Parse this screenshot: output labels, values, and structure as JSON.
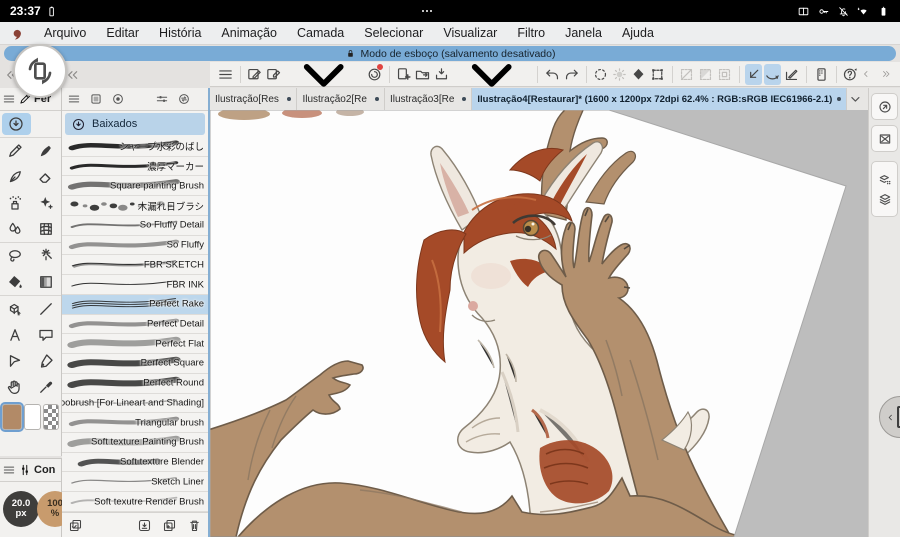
{
  "colors": {
    "banner_blue": "#79abd6",
    "selection_blue": "#b9d4ec",
    "workspace_gray": "#bdbdbd",
    "foreground_swatch": "#b28a67",
    "mane_red": "#a54a28",
    "body_cream": "#f2ece3",
    "skin_tan": "#b3906e"
  },
  "status_bar": {
    "time": "23:37",
    "left_icons": [
      "battery-small-icon"
    ],
    "center_icon": "three-dots-icon",
    "right_icons": [
      "book-icon",
      "key-icon",
      "bell-off-icon",
      "wifi-icon",
      "battery-icon"
    ]
  },
  "menu_bar": {
    "logo_icon": "medibang-logo",
    "items": [
      "Arquivo",
      "Editar",
      "História",
      "Animação",
      "Camada",
      "Selecionar",
      "Visualizar",
      "Filtro",
      "Janela",
      "Ajuda"
    ]
  },
  "notice_bar": {
    "icon": "lock-icon",
    "text": "Modo de esboço (salvamento desativado)"
  },
  "collapse_buttons": [
    {
      "icon": "collapse-icon",
      "name": "collapse-tool-panel"
    },
    {
      "icon": "collapse-icon",
      "name": "collapse-brush-panel"
    }
  ],
  "toolbar": {
    "buttons": [
      {
        "icon": "hamburger-icon"
      },
      {
        "divider": true
      },
      {
        "icon": "new-canvas-icon"
      },
      {
        "icon": "export-image-icon",
        "chevron": true
      },
      {
        "icon": "gallery-icon",
        "badge": true
      },
      {
        "divider": true
      },
      {
        "icon": "add-file-icon"
      },
      {
        "icon": "open-folder-icon"
      },
      {
        "icon": "save-export-icon",
        "chevron": true
      },
      {
        "divider": true
      },
      {
        "icon": "undo-icon"
      },
      {
        "icon": "redo-icon"
      },
      {
        "divider": true
      },
      {
        "icon": "spinner-icon"
      },
      {
        "icon": "brightness-icon",
        "disabled": true
      },
      {
        "icon": "fill-icon"
      },
      {
        "icon": "transform-icon"
      },
      {
        "divider": true
      },
      {
        "icon": "select-none-icon",
        "disabled": true
      },
      {
        "icon": "select-inverse-icon",
        "disabled": true
      },
      {
        "icon": "select-rect-icon",
        "disabled": true
      },
      {
        "divider": true
      },
      {
        "icon": "snap-corner-icon",
        "active": true
      },
      {
        "icon": "snap-curve-icon",
        "active": true
      },
      {
        "icon": "snap-angle-icon"
      },
      {
        "divider": true
      },
      {
        "icon": "material-panel-icon"
      },
      {
        "divider": true
      },
      {
        "icon": "help-icon"
      }
    ],
    "overflow_icons": [
      "chevron-left-icon",
      "chevrons-right-icon"
    ]
  },
  "tool_panel": {
    "menu_icon": "hamburger-icon",
    "tab_icon": "pen-icon",
    "tab_label": "Fer",
    "tools": [
      {
        "icon": "downloaded-brushes-icon",
        "selected": true
      },
      {
        "icon": null
      },
      {
        "icon": "pen-icon"
      },
      {
        "icon": "brushpen-icon"
      },
      {
        "icon": "inkpen-icon"
      },
      {
        "icon": "eraser-icon"
      },
      {
        "icon": "airbrush-icon"
      },
      {
        "icon": "decoration-icon"
      },
      {
        "icon": "blend-icon"
      },
      {
        "icon": "mesh-icon"
      },
      {
        "icon": "lasso-icon"
      },
      {
        "icon": "magic-wand-icon"
      },
      {
        "icon": "bucket-icon"
      },
      {
        "icon": "gradient-icon"
      },
      {
        "icon": "operation-icon"
      },
      {
        "icon": "line-icon"
      },
      {
        "icon": "text-icon"
      },
      {
        "icon": "balloon-icon"
      },
      {
        "icon": "polygon-select-icon"
      },
      {
        "icon": "control-point-icon"
      },
      {
        "icon": "hand-icon"
      },
      {
        "icon": "eyedropper-icon"
      }
    ],
    "swatches": [
      {
        "name": "foreground-swatch",
        "color": "#b28a67",
        "selected": true
      },
      {
        "name": "background-swatch",
        "color": "#ffffff",
        "selected": false
      },
      {
        "name": "transparent-swatch",
        "pattern": "checker",
        "selected": false
      }
    ]
  },
  "config_panel": {
    "menu_icon": "hamburger-icon",
    "tab_icon": "sliders-icon",
    "tab_label": "Con",
    "brush_size": {
      "value": "20.0",
      "unit": "px"
    },
    "opacity": {
      "value": "100",
      "unit": "%"
    }
  },
  "brush_panel": {
    "tabs": [
      {
        "icon": "hamburger-icon"
      },
      {
        "icon": "layer-thumb-icon"
      },
      {
        "icon": "record-icon"
      },
      {
        "icon": "brush-tab-icon",
        "active": true
      },
      {
        "icon": "settings-icon"
      },
      {
        "icon": "transfer-icon"
      }
    ],
    "downloads_row": {
      "icon": "download-circle-icon",
      "label": "Baixados",
      "selected": true
    },
    "brushes": [
      {
        "name": "シャープ水彩のばし",
        "stroke": "thick",
        "selected": false
      },
      {
        "name": "濃厚マーカー",
        "stroke": "taper",
        "selected": false
      },
      {
        "name": "Square painting Brush",
        "stroke": "soft-dark",
        "selected": false
      },
      {
        "name": "木漏れ日ブラシ",
        "stroke": "dots",
        "selected": false
      },
      {
        "name": "So Fluffy Detail",
        "stroke": "fine-soft",
        "selected": false
      },
      {
        "name": "So Fluffy",
        "stroke": "soft",
        "selected": false
      },
      {
        "name": "FBR SKETCH",
        "stroke": "sketch",
        "selected": false
      },
      {
        "name": "FBR INK",
        "stroke": "thin",
        "selected": false
      },
      {
        "name": "Perfect Rake",
        "stroke": "rake",
        "selected": true
      },
      {
        "name": "Perfect Detail",
        "stroke": "soft",
        "selected": false
      },
      {
        "name": "Perfect Flat",
        "stroke": "soft-wide",
        "selected": false
      },
      {
        "name": "Perfect Square",
        "stroke": "dark-wide",
        "selected": false
      },
      {
        "name": "Perfect Round",
        "stroke": "dark-wide",
        "selected": false
      },
      {
        "name": "yoobrush [For Lineart and Shading]",
        "stroke": "thin-faint",
        "selected": false
      },
      {
        "name": "Triangular brush",
        "stroke": "soft",
        "selected": false
      },
      {
        "name": "Soft texture Painting Brush",
        "stroke": "soft-wide",
        "selected": false
      },
      {
        "name": "Soft texture Blender",
        "stroke": "blob",
        "selected": false
      },
      {
        "name": "Sketch Liner",
        "stroke": "thin-faint",
        "selected": false
      },
      {
        "name": "Soft texutre Render Brush",
        "stroke": "faint",
        "selected": false
      }
    ],
    "footer_icons": [
      "multiselect-icon",
      "download-icon",
      "duplicate-icon",
      "trash-icon"
    ]
  },
  "document_tabs": {
    "tabs": [
      {
        "label": "Ilustração[Res",
        "active": false
      },
      {
        "label": "Ilustração2[Re",
        "active": false
      },
      {
        "label": "Ilustração3[Re",
        "active": false
      },
      {
        "label": "Ilustração4[Restaurar]* (1600 x 1200px 72dpi 62.4% : RGB:sRGB IEC61966-2.1)",
        "active": true
      }
    ],
    "more_icon": "chevron-down-icon"
  },
  "right_sidebar": {
    "buttons": [
      "nav-zoom-icon",
      "no-image-icon"
    ],
    "layer_group": [
      "layer-settings-icon",
      "layers-icon"
    ]
  },
  "floating": {
    "rotate_button_icon": "rotate-device-icon",
    "edge_handle_icon": "chevron-left-icon"
  }
}
